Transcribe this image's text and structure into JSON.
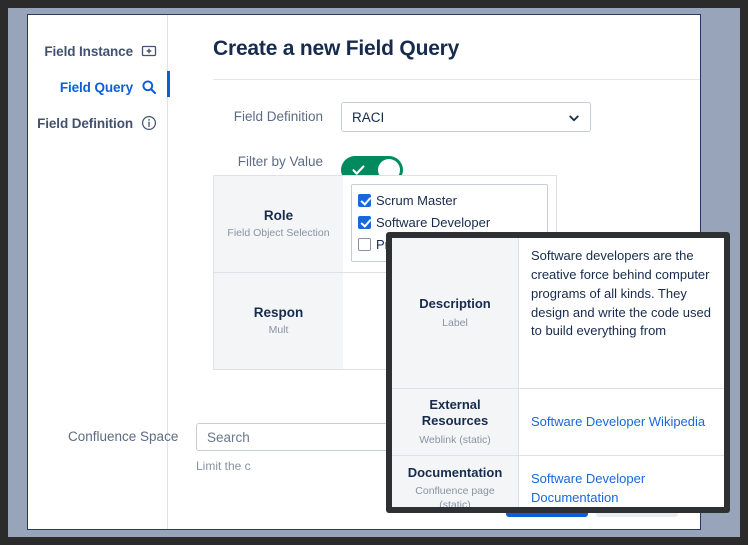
{
  "sidebar": {
    "items": [
      {
        "label": "Field Instance",
        "icon": "field-instance-icon",
        "active": false
      },
      {
        "label": "Field Query",
        "icon": "search-icon",
        "active": true
      },
      {
        "label": "Field Definition",
        "icon": "info-icon",
        "active": false
      }
    ]
  },
  "main": {
    "title": "Create a new Field Query",
    "field_definition": {
      "label": "Field Definition",
      "value": "RACI"
    },
    "filter_by_value": {
      "label": "Filter by Value",
      "enabled": true
    },
    "confluence_space": {
      "label": "Confluence Space",
      "placeholder": "Search",
      "helper": "Limit the c"
    }
  },
  "field_table": {
    "rows": [
      {
        "name": "Role",
        "subtitle": "Field Object Selection",
        "options": [
          {
            "label": "Scrum Master",
            "checked": true
          },
          {
            "label": "Software Developer",
            "checked": true
          },
          {
            "label": "Product Owner",
            "checked": false
          }
        ]
      },
      {
        "name": "Respon",
        "subtitle": "Mult"
      }
    ]
  },
  "tooltip": {
    "rows": [
      {
        "name": "Description",
        "subtitle": "Label",
        "value": "Software developers are the creative force behind computer programs of all kinds. They design and write the code used to build everything from",
        "is_link": false
      },
      {
        "name": "External Resources",
        "subtitle": "Weblink (static)",
        "value": "Software Developer Wikipedia",
        "is_link": true
      },
      {
        "name": "Documentation",
        "subtitle": "Confluence page (static)",
        "value": "Software Developer Documentation",
        "is_link": true
      }
    ]
  },
  "footer": {
    "primary_label": "",
    "secondary_label": ""
  },
  "colors": {
    "accent_blue": "#0b5ed7",
    "toggle_green": "#008a5e",
    "link_blue": "#1868db",
    "backdrop": "#98a4ba"
  }
}
